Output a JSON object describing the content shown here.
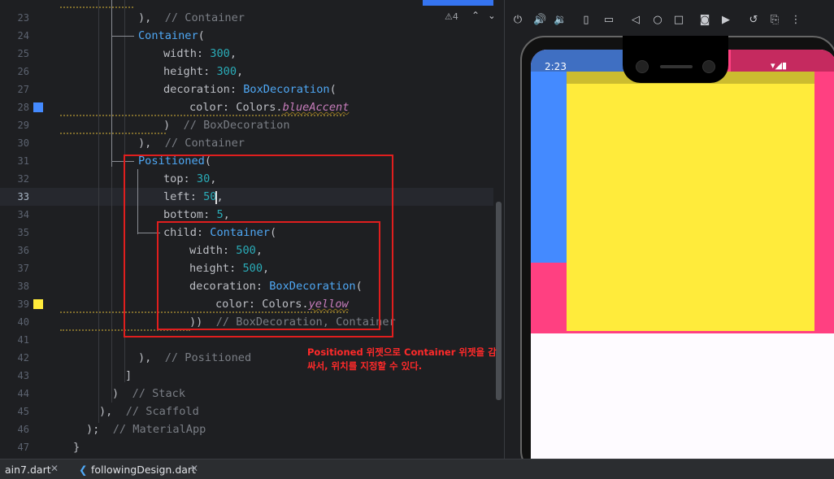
{
  "editor": {
    "lines": [
      {
        "n": "23",
        "segs": [
          {
            "t": "),  ",
            "c": ""
          },
          {
            "t": "// Container",
            "c": "cmt"
          }
        ],
        "indent": 170
      },
      {
        "n": "24",
        "segs": [
          {
            "t": "Container",
            "c": "cls"
          },
          {
            "t": "(",
            "c": ""
          }
        ],
        "indent": 170
      },
      {
        "n": "25",
        "segs": [
          {
            "t": "width: ",
            "c": ""
          },
          {
            "t": "300",
            "c": "num"
          },
          {
            "t": ",",
            "c": ""
          }
        ],
        "indent": 201
      },
      {
        "n": "26",
        "segs": [
          {
            "t": "height: ",
            "c": ""
          },
          {
            "t": "300",
            "c": "num"
          },
          {
            "t": ",",
            "c": ""
          }
        ],
        "indent": 201
      },
      {
        "n": "27",
        "segs": [
          {
            "t": "decoration: ",
            "c": ""
          },
          {
            "t": "BoxDecoration",
            "c": "cls"
          },
          {
            "t": "(",
            "c": ""
          }
        ],
        "indent": 201
      },
      {
        "n": "28",
        "segs": [
          {
            "t": "color: Colors.",
            "c": ""
          },
          {
            "t": "blueAccent",
            "c": "ital"
          }
        ],
        "indent": 233
      },
      {
        "n": "29",
        "segs": [
          {
            "t": ")  ",
            "c": ""
          },
          {
            "t": "// BoxDecoration",
            "c": "cmt"
          }
        ],
        "indent": 201
      },
      {
        "n": "30",
        "segs": [
          {
            "t": "),  ",
            "c": ""
          },
          {
            "t": "// Container",
            "c": "cmt"
          }
        ],
        "indent": 170
      },
      {
        "n": "31",
        "segs": [
          {
            "t": "Positioned",
            "c": "cls"
          },
          {
            "t": "(",
            "c": ""
          }
        ],
        "indent": 170
      },
      {
        "n": "32",
        "segs": [
          {
            "t": "top: ",
            "c": ""
          },
          {
            "t": "30",
            "c": "num"
          },
          {
            "t": ",",
            "c": ""
          }
        ],
        "indent": 201
      },
      {
        "n": "33",
        "segs": [
          {
            "t": "left: ",
            "c": ""
          },
          {
            "t": "50",
            "c": "num"
          },
          {
            "t": ",",
            "c": ""
          }
        ],
        "indent": 201
      },
      {
        "n": "34",
        "segs": [
          {
            "t": "bottom: ",
            "c": ""
          },
          {
            "t": "5",
            "c": "num"
          },
          {
            "t": ",",
            "c": ""
          }
        ],
        "indent": 201
      },
      {
        "n": "35",
        "segs": [
          {
            "t": "child: ",
            "c": ""
          },
          {
            "t": "Container",
            "c": "cls"
          },
          {
            "t": "(",
            "c": ""
          }
        ],
        "indent": 201
      },
      {
        "n": "36",
        "segs": [
          {
            "t": "width: ",
            "c": ""
          },
          {
            "t": "500",
            "c": "num"
          },
          {
            "t": ",",
            "c": ""
          }
        ],
        "indent": 233
      },
      {
        "n": "37",
        "segs": [
          {
            "t": "height: ",
            "c": ""
          },
          {
            "t": "500",
            "c": "num"
          },
          {
            "t": ",",
            "c": ""
          }
        ],
        "indent": 233
      },
      {
        "n": "38",
        "segs": [
          {
            "t": "decoration: ",
            "c": ""
          },
          {
            "t": "BoxDecoration",
            "c": "cls"
          },
          {
            "t": "(",
            "c": ""
          }
        ],
        "indent": 233
      },
      {
        "n": "39",
        "segs": [
          {
            "t": "color: Colors.",
            "c": ""
          },
          {
            "t": "yellow",
            "c": "ital"
          }
        ],
        "indent": 265
      },
      {
        "n": "40",
        "segs": [
          {
            "t": "))  ",
            "c": ""
          },
          {
            "t": "// BoxDecoration, Container",
            "c": "cmt"
          }
        ],
        "indent": 233
      },
      {
        "n": "41",
        "segs": [],
        "indent": 170
      },
      {
        "n": "42",
        "segs": [
          {
            "t": "),  ",
            "c": ""
          },
          {
            "t": "// Positioned",
            "c": "cmt"
          }
        ],
        "indent": 170
      },
      {
        "n": "43",
        "segs": [
          {
            "t": "]",
            "c": ""
          }
        ],
        "indent": 154
      },
      {
        "n": "44",
        "segs": [
          {
            "t": ")  ",
            "c": ""
          },
          {
            "t": "// Stack",
            "c": "cmt"
          }
        ],
        "indent": 138
      },
      {
        "n": "45",
        "segs": [
          {
            "t": "),  ",
            "c": ""
          },
          {
            "t": "// Scaffold",
            "c": "cmt"
          }
        ],
        "indent": 122
      },
      {
        "n": "46",
        "segs": [
          {
            "t": ");  ",
            "c": ""
          },
          {
            "t": "// MaterialApp",
            "c": "cmt"
          }
        ],
        "indent": 106
      },
      {
        "n": "47",
        "segs": [
          {
            "t": "}",
            "c": ""
          }
        ],
        "indent": 90
      }
    ],
    "current_line": "33",
    "warning_count": "4",
    "annotation": "Positioned 위젯으로 Container 위젯을 감싸서, 위치를 지정할 수 있다.",
    "gutter_colors": {
      "28": "#448aff",
      "39": "#ffeb3b"
    }
  },
  "tabs": [
    {
      "label": "ain7.dart"
    },
    {
      "label": "followingDesign.dart"
    }
  ],
  "emulator": {
    "time": "2:23",
    "colors": {
      "blue": "#448aff",
      "yellow": "#ffeb3b",
      "pink": "#ff4081",
      "bg": "#fefbff"
    },
    "toolbar_icons": [
      "power-icon",
      "volume-up-icon",
      "volume-down-icon",
      "rotate-left-icon",
      "rotate-right-icon",
      "back-icon",
      "home-icon",
      "overview-icon",
      "screenshot-icon",
      "record-icon",
      "reset-icon",
      "snapshot-icon",
      "more-icon"
    ]
  }
}
